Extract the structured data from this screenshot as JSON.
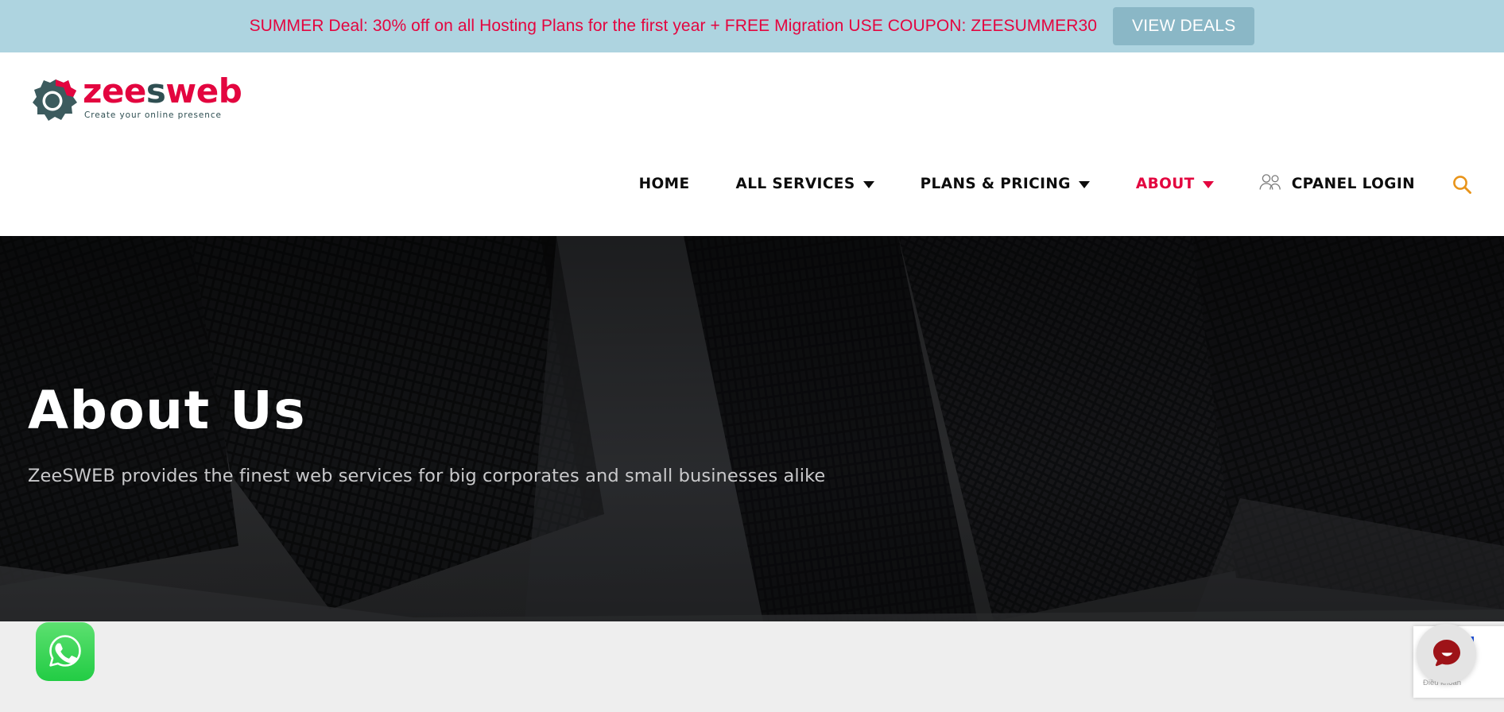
{
  "promo": {
    "text": "SUMMER Deal: 30% off on all Hosting Plans for the first year + FREE Migration USE COUPON: ZEESUMMER30",
    "button_label": "VIEW DEALS",
    "bg_color": "#aed4e0",
    "text_color": "#e3053f",
    "button_bg": "#8ab7c6"
  },
  "logo": {
    "word_part1": "zee",
    "word_part2": "s",
    "word_part3": "web",
    "tagline": "Create your online presence",
    "red": "#e3053f",
    "dark": "#2f4f52"
  },
  "nav": {
    "items": [
      {
        "label": "HOME",
        "has_caret": false,
        "active": false
      },
      {
        "label": "ALL SERVICES",
        "has_caret": true,
        "active": false
      },
      {
        "label": "PLANS & PRICING",
        "has_caret": true,
        "active": false
      },
      {
        "label": "ABOUT",
        "has_caret": true,
        "active": true
      }
    ],
    "cpanel_label": "CPANEL LOGIN",
    "active_color": "#e3053f",
    "search_icon_color": "#e8941a"
  },
  "hero": {
    "title": "About Us",
    "subtitle": "ZeeSWEB provides the finest web services for big corporates and small businesses alike"
  },
  "widgets": {
    "whatsapp_label": "whatsapp-chat",
    "chat_label": "open-chat",
    "recaptcha_terms": "Điều khoản"
  }
}
